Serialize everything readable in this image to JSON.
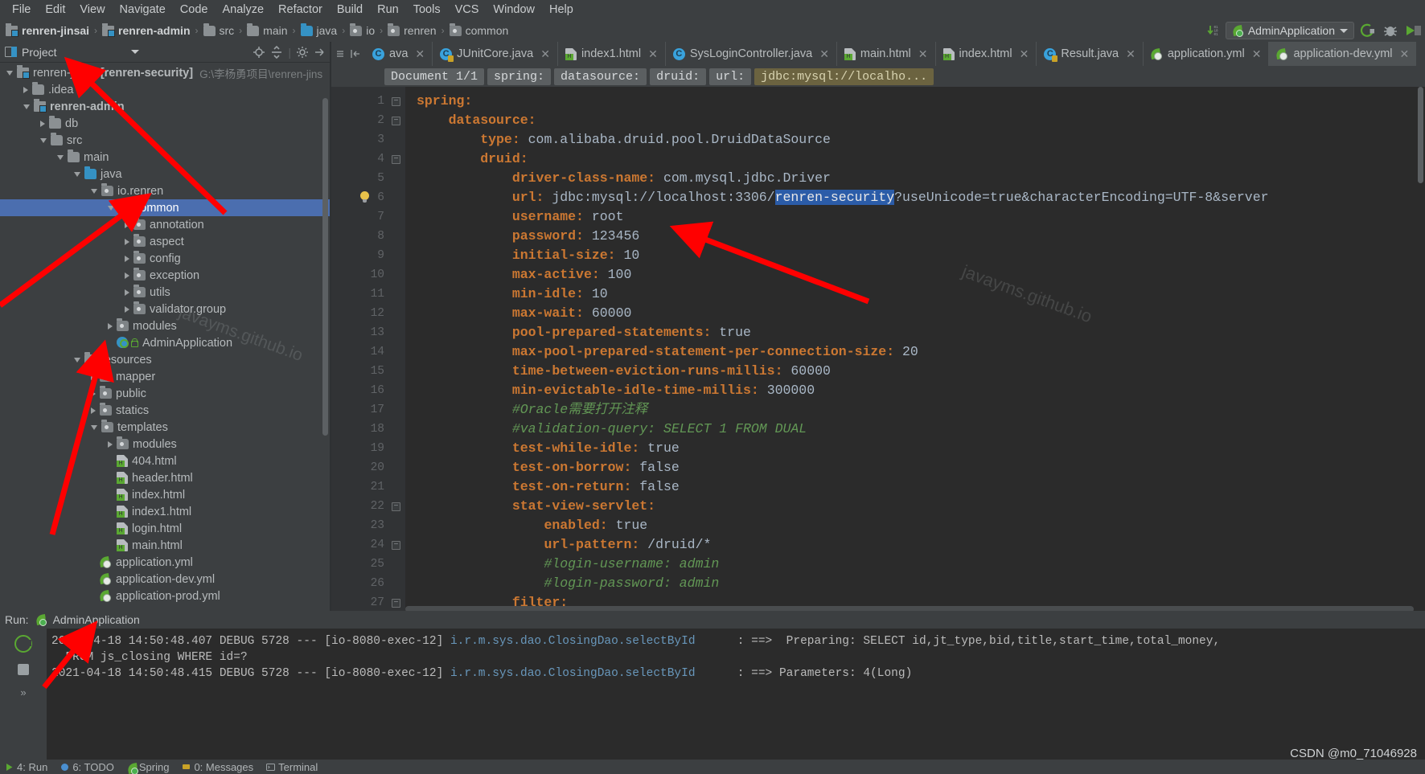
{
  "menubar": {
    "items": [
      "File",
      "Edit",
      "View",
      "Navigate",
      "Code",
      "Analyze",
      "Refactor",
      "Build",
      "Run",
      "Tools",
      "VCS",
      "Window",
      "Help"
    ]
  },
  "breadcrumb_nav": {
    "items": [
      {
        "label": "renren-jinsai",
        "icon": "module-icon",
        "bold": true
      },
      {
        "label": "renren-admin",
        "icon": "module-icon",
        "bold": true
      },
      {
        "label": "src",
        "icon": "folder-icon",
        "bold": false
      },
      {
        "label": "main",
        "icon": "folder-icon",
        "bold": false
      },
      {
        "label": "java",
        "icon": "source-folder-icon",
        "bold": false
      },
      {
        "label": "io",
        "icon": "package-icon",
        "bold": false
      },
      {
        "label": "renren",
        "icon": "package-icon",
        "bold": false
      },
      {
        "label": "common",
        "icon": "package-icon",
        "bold": false
      }
    ],
    "separator": "›"
  },
  "toolbar_right": {
    "run_config": "AdminApplication",
    "icons": [
      "sync-icon",
      "run-icon",
      "debug-icon",
      "run-coverage-icon"
    ]
  },
  "project_panel": {
    "title": "Project",
    "header_icons": [
      "locate-icon",
      "collapse-all-icon",
      "settings-icon"
    ],
    "tree": [
      {
        "depth": 0,
        "state": "open",
        "icon": "module-icon",
        "label": "renren-jinsai [renren-security]",
        "bold_part": "[renren-security]",
        "path": "G:\\李杨勇项目\\renren-jins",
        "selected": false
      },
      {
        "depth": 1,
        "state": "closed",
        "icon": "folder-icon",
        "label": ".idea",
        "selected": false
      },
      {
        "depth": 1,
        "state": "open",
        "icon": "module-icon",
        "label": "renren-admin",
        "bold": true,
        "selected": false
      },
      {
        "depth": 2,
        "state": "closed",
        "icon": "folder-icon",
        "label": "db",
        "selected": false
      },
      {
        "depth": 2,
        "state": "open",
        "icon": "folder-icon",
        "label": "src",
        "selected": false
      },
      {
        "depth": 3,
        "state": "open",
        "icon": "folder-icon",
        "label": "main",
        "selected": false
      },
      {
        "depth": 4,
        "state": "open",
        "icon": "source-folder-icon",
        "label": "java",
        "selected": false
      },
      {
        "depth": 5,
        "state": "open",
        "icon": "package-icon",
        "label": "io.renren",
        "selected": false
      },
      {
        "depth": 6,
        "state": "open",
        "icon": "package-icon",
        "label": "common",
        "selected": true
      },
      {
        "depth": 7,
        "state": "closed",
        "icon": "package-icon",
        "label": "annotation",
        "selected": false
      },
      {
        "depth": 7,
        "state": "closed",
        "icon": "package-icon",
        "label": "aspect",
        "selected": false
      },
      {
        "depth": 7,
        "state": "closed",
        "icon": "package-icon",
        "label": "config",
        "selected": false
      },
      {
        "depth": 7,
        "state": "closed",
        "icon": "package-icon",
        "label": "exception",
        "selected": false
      },
      {
        "depth": 7,
        "state": "closed",
        "icon": "package-icon",
        "label": "utils",
        "selected": false
      },
      {
        "depth": 7,
        "state": "closed",
        "icon": "package-icon",
        "label": "validator.group",
        "selected": false
      },
      {
        "depth": 6,
        "state": "closed",
        "icon": "package-icon",
        "label": "modules",
        "selected": false
      },
      {
        "depth": 6,
        "state": "leaf",
        "icon": "spring-class-icon",
        "label": "AdminApplication",
        "runnable": true,
        "selected": false
      },
      {
        "depth": 4,
        "state": "open",
        "icon": "resources-folder-icon",
        "label": "resources",
        "selected": false
      },
      {
        "depth": 5,
        "state": "closed",
        "icon": "package-icon",
        "label": "mapper",
        "selected": false
      },
      {
        "depth": 5,
        "state": "closed",
        "icon": "package-icon",
        "label": "public",
        "selected": false
      },
      {
        "depth": 5,
        "state": "closed",
        "icon": "package-icon",
        "label": "statics",
        "selected": false
      },
      {
        "depth": 5,
        "state": "open",
        "icon": "package-icon",
        "label": "templates",
        "selected": false
      },
      {
        "depth": 6,
        "state": "closed",
        "icon": "package-icon",
        "label": "modules",
        "selected": false
      },
      {
        "depth": 6,
        "state": "leaf",
        "icon": "html-file-icon",
        "label": "404.html",
        "selected": false
      },
      {
        "depth": 6,
        "state": "leaf",
        "icon": "html-file-icon",
        "label": "header.html",
        "selected": false
      },
      {
        "depth": 6,
        "state": "leaf",
        "icon": "html-file-icon",
        "label": "index.html",
        "selected": false
      },
      {
        "depth": 6,
        "state": "leaf",
        "icon": "html-file-icon",
        "label": "index1.html",
        "selected": false
      },
      {
        "depth": 6,
        "state": "leaf",
        "icon": "html-file-icon",
        "label": "login.html",
        "selected": false
      },
      {
        "depth": 6,
        "state": "leaf",
        "icon": "html-file-icon",
        "label": "main.html",
        "selected": false
      },
      {
        "depth": 5,
        "state": "leaf",
        "icon": "yml-file-icon",
        "label": "application.yml",
        "selected": false
      },
      {
        "depth": 5,
        "state": "leaf",
        "icon": "yml-file-icon",
        "label": "application-dev.yml",
        "selected": false
      },
      {
        "depth": 5,
        "state": "leaf",
        "icon": "yml-file-icon",
        "label": "application-prod.yml",
        "selected": false
      }
    ]
  },
  "editor_tabs": [
    {
      "label": "ava",
      "icon": "java-class-icon",
      "active": false,
      "partial": true
    },
    {
      "label": "JUnitCore.java",
      "icon": "java-class-icon-locked",
      "active": false
    },
    {
      "label": "index1.html",
      "icon": "html-file-icon",
      "active": false
    },
    {
      "label": "SysLoginController.java",
      "icon": "java-class-icon",
      "active": false
    },
    {
      "label": "main.html",
      "icon": "html-file-icon",
      "active": false
    },
    {
      "label": "index.html",
      "icon": "html-file-icon",
      "active": false
    },
    {
      "label": "Result.java",
      "icon": "java-class-icon-locked",
      "active": false
    },
    {
      "label": "application.yml",
      "icon": "yml-file-icon",
      "active": false
    },
    {
      "label": "application-dev.yml",
      "icon": "yml-file-icon",
      "active": true
    }
  ],
  "editor_breadcrumbs": [
    {
      "label": "Document 1/1",
      "highlight": false
    },
    {
      "label": "spring:",
      "highlight": false
    },
    {
      "label": "datasource:",
      "highlight": false
    },
    {
      "label": "druid:",
      "highlight": false
    },
    {
      "label": "url:",
      "highlight": false
    },
    {
      "label": "jdbc:mysql://localho...",
      "highlight": true
    }
  ],
  "code": {
    "lines": [
      {
        "n": 1,
        "indent": 0,
        "key": "spring:",
        "value": "",
        "type": "key",
        "fold": "open"
      },
      {
        "n": 2,
        "indent": 1,
        "key": "datasource:",
        "value": "",
        "type": "key",
        "fold": "open"
      },
      {
        "n": 3,
        "indent": 2,
        "key": "type:",
        "value": "com.alibaba.druid.pool.DruidDataSource",
        "type": "key"
      },
      {
        "n": 4,
        "indent": 2,
        "key": "druid:",
        "value": "",
        "type": "key",
        "fold": "open"
      },
      {
        "n": 5,
        "indent": 3,
        "key": "driver-class-name:",
        "value": "com.mysql.jdbc.Driver",
        "type": "key"
      },
      {
        "n": 6,
        "indent": 3,
        "key": "url:",
        "value": "jdbc:mysql://localhost:3306/",
        "type": "url",
        "highlighted": "renren-security",
        "value_tail": "?useUnicode=true&characterEncoding=UTF-8&server",
        "bulb": true
      },
      {
        "n": 7,
        "indent": 3,
        "key": "username:",
        "value": "root",
        "type": "key"
      },
      {
        "n": 8,
        "indent": 3,
        "key": "password:",
        "value": "123456",
        "type": "key"
      },
      {
        "n": 9,
        "indent": 3,
        "key": "initial-size:",
        "value": "10",
        "type": "key"
      },
      {
        "n": 10,
        "indent": 3,
        "key": "max-active:",
        "value": "100",
        "type": "key"
      },
      {
        "n": 11,
        "indent": 3,
        "key": "min-idle:",
        "value": "10",
        "type": "key"
      },
      {
        "n": 12,
        "indent": 3,
        "key": "max-wait:",
        "value": "60000",
        "type": "key"
      },
      {
        "n": 13,
        "indent": 3,
        "key": "pool-prepared-statements:",
        "value": "true",
        "type": "key"
      },
      {
        "n": 14,
        "indent": 3,
        "key": "max-pool-prepared-statement-per-connection-size:",
        "value": "20",
        "type": "key"
      },
      {
        "n": 15,
        "indent": 3,
        "key": "time-between-eviction-runs-millis:",
        "value": "60000",
        "type": "key"
      },
      {
        "n": 16,
        "indent": 3,
        "key": "min-evictable-idle-time-millis:",
        "value": "300000",
        "type": "key"
      },
      {
        "n": 17,
        "indent": 3,
        "key": "#Oracle需要打开注释",
        "value": "",
        "type": "comment"
      },
      {
        "n": 18,
        "indent": 3,
        "key": "#validation-query:",
        "value": "SELECT 1 FROM DUAL",
        "type": "comment"
      },
      {
        "n": 19,
        "indent": 3,
        "key": "test-while-idle:",
        "value": "true",
        "type": "key"
      },
      {
        "n": 20,
        "indent": 3,
        "key": "test-on-borrow:",
        "value": "false",
        "type": "key"
      },
      {
        "n": 21,
        "indent": 3,
        "key": "test-on-return:",
        "value": "false",
        "type": "key"
      },
      {
        "n": 22,
        "indent": 3,
        "key": "stat-view-servlet:",
        "value": "",
        "type": "key",
        "fold": "open"
      },
      {
        "n": 23,
        "indent": 4,
        "key": "enabled:",
        "value": "true",
        "type": "key"
      },
      {
        "n": 24,
        "indent": 4,
        "key": "url-pattern:",
        "value": "/druid/*",
        "type": "key",
        "fold": "open"
      },
      {
        "n": 25,
        "indent": 4,
        "key": "#login-username:",
        "value": "admin",
        "type": "comment"
      },
      {
        "n": 26,
        "indent": 4,
        "key": "#login-password:",
        "value": "admin",
        "type": "comment"
      },
      {
        "n": 27,
        "indent": 3,
        "key": "filter:",
        "value": "",
        "type": "key",
        "fold": "open"
      }
    ]
  },
  "run_panel": {
    "title": "Run:",
    "config_name": "AdminApplication",
    "console_lines": [
      {
        "segments": [
          {
            "t": "2021-04-18 14:50:48.407 DEBUG 5728 --- [io-8080-exec-12] ",
            "c": "gray"
          },
          {
            "t": "i.r.m.sys.dao.ClosingDao.selectById",
            "c": "blue"
          },
          {
            "t": "      : ==>  Preparing: SELECT id,jt_type,bid,title,start_time,total_money,",
            "c": "gray"
          }
        ]
      },
      {
        "segments": [
          {
            "t": "  FROM js_closing WHERE id=?",
            "c": "gray"
          }
        ]
      },
      {
        "segments": [
          {
            "t": "2021-04-18 14:50:48.415 DEBUG 5728 --- [io-8080-exec-12] ",
            "c": "gray"
          },
          {
            "t": "i.r.m.sys.dao.ClosingDao.selectById",
            "c": "blue"
          },
          {
            "t": "      : ==> Parameters: 4(Long)",
            "c": "gray"
          }
        ]
      }
    ]
  },
  "statusbar": {
    "items": [
      "4: Run",
      "6: TODO",
      "Spring",
      "0: Messages",
      "Terminal"
    ],
    "watermark": "CSDN @m0_71046928"
  },
  "watermarks": [
    "javayms.github.io",
    "javayms.github.io"
  ]
}
